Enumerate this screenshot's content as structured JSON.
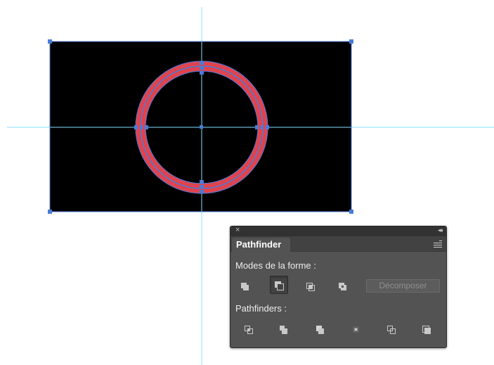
{
  "panel": {
    "close_glyph": "×",
    "collapse_glyph": "◂◂",
    "tab_label": "Pathfinder",
    "menu_icon": "panel-menu-icon",
    "shape_modes_label": "Modes de la forme :",
    "shape_modes": [
      {
        "name": "unite",
        "icon": "unite-icon",
        "active": false
      },
      {
        "name": "minus-front",
        "icon": "minus-front-icon",
        "active": true
      },
      {
        "name": "intersect",
        "icon": "intersect-icon",
        "active": false
      },
      {
        "name": "exclude",
        "icon": "exclude-icon",
        "active": false
      }
    ],
    "expand_label": "Décomposer",
    "pathfinders_label": "Pathfinders :",
    "pathfinders": [
      {
        "name": "divide",
        "icon": "divide-icon"
      },
      {
        "name": "trim",
        "icon": "trim-icon"
      },
      {
        "name": "merge",
        "icon": "merge-icon"
      },
      {
        "name": "crop",
        "icon": "crop-icon"
      },
      {
        "name": "outline",
        "icon": "outline-icon"
      },
      {
        "name": "minus-back",
        "icon": "minus-back-icon"
      }
    ]
  },
  "colors": {
    "guide": "#86e1ff",
    "selection": "#4a7bd8",
    "ring": "#e0434e",
    "rectangle": "#000000",
    "panel_bg": "#535353"
  }
}
